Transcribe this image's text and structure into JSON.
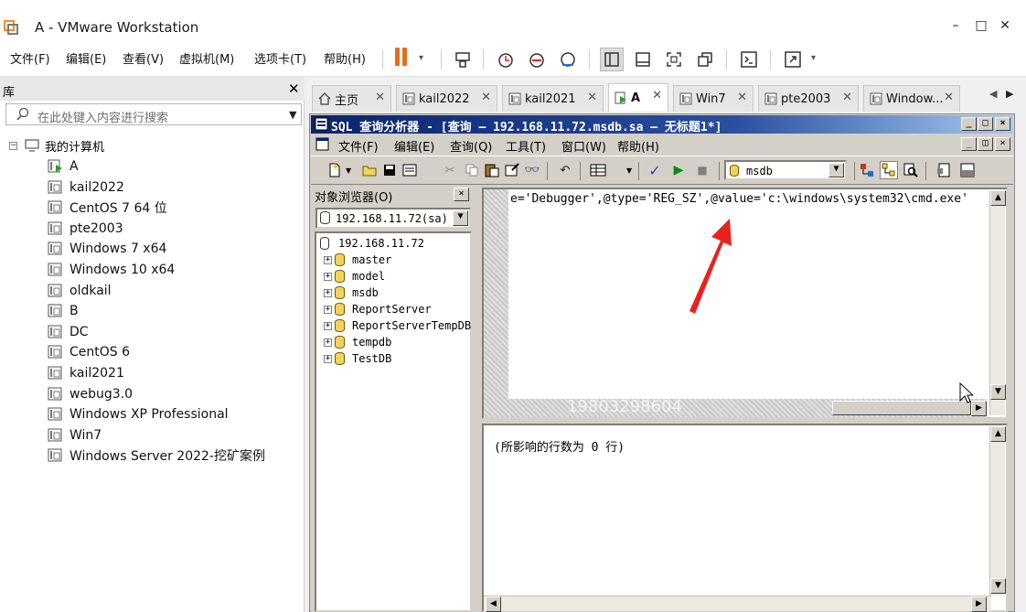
{
  "window": {
    "title": "A - VMware Workstation",
    "minimize": "–",
    "maximize": "□",
    "close": "✕"
  },
  "menubar": {
    "items": [
      "文件(F)",
      "编辑(E)",
      "查看(V)",
      "虚拟机(M)",
      "选项卡(T)",
      "帮助(H)"
    ]
  },
  "library": {
    "title": "库",
    "close": "✕",
    "search_placeholder": "在此处键入内容进行搜索",
    "root": "我的计算机",
    "items": [
      "A",
      "kail2022",
      "CentOS 7 64 位",
      "pte2003",
      "Windows 7 x64",
      "Windows 10 x64",
      "oldkail",
      "B",
      "DC",
      "CentOS 6",
      "kail2021",
      "webug3.0",
      "Windows XP Professional",
      "Win7",
      "Windows Server 2022-挖矿案例"
    ]
  },
  "tabs": [
    {
      "label": "主页",
      "close": "✕"
    },
    {
      "label": "kail2022",
      "close": "✕"
    },
    {
      "label": "kail2021",
      "close": "✕"
    },
    {
      "label": "A",
      "close": "✕"
    },
    {
      "label": "Win7",
      "close": "✕"
    },
    {
      "label": "pte2003",
      "close": "✕"
    },
    {
      "label": "Window...",
      "close": "✕"
    }
  ],
  "sql": {
    "title": "SQL 查询分析器 - [查询 — 192.168.11.72.msdb.sa — 无标题1*]",
    "menu": [
      "文件(F)",
      "编辑(E)",
      "查询(Q)",
      "工具(T)",
      "窗口(W)",
      "帮助(H)"
    ],
    "database": "msdb",
    "object_browser_title": "对象浏览器(O)",
    "server_select": "192.168.11.72(sa)",
    "server_node": "192.168.11.72",
    "databases": [
      "master",
      "model",
      "msdb",
      "ReportServer",
      "ReportServerTempDB",
      "tempdb",
      "TestDB"
    ],
    "query_text": "e='Debugger',@type='REG_SZ',@value='c:\\windows\\system32\\cmd.exe'",
    "result_text": "(所影响的行数为 0 行)"
  },
  "watermark": "19803298604",
  "colors": {
    "accent_orange": "#ea6a1c",
    "xp_title_start": "#0a246a",
    "arrow_red": "#e8221f"
  }
}
